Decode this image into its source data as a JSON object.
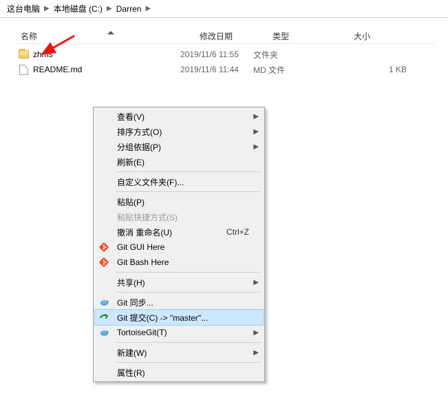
{
  "breadcrumb": {
    "seg1": "这台电脑",
    "seg2": "本地磁盘 (C:)",
    "seg3": "Darren"
  },
  "columns": {
    "name": "名称",
    "date": "修改日期",
    "type": "类型",
    "size": "大小"
  },
  "files": [
    {
      "name": "zhms",
      "date": "2019/11/6 11:55",
      "type": "文件夹",
      "size": "",
      "kind": "folder"
    },
    {
      "name": "README.md",
      "date": "2019/11/6 11:44",
      "type": "MD 文件",
      "size": "1 KB",
      "kind": "file"
    }
  ],
  "menu": {
    "view": "查看(V)",
    "sort": "排序方式(O)",
    "group": "分组依据(P)",
    "refresh": "刷新(E)",
    "customize": "自定义文件夹(F)...",
    "paste": "粘贴(P)",
    "paste_shortcut": "粘贴快捷方式(S)",
    "undo": "撤消 重命名(U)",
    "undo_key": "Ctrl+Z",
    "git_gui": "Git GUI Here",
    "git_bash": "Git Bash Here",
    "share": "共享(H)",
    "git_sync": "Git 同步...",
    "git_commit": "Git 提交(C) -> \"master\"...",
    "tortoise": "TortoiseGit(T)",
    "new": "新建(W)",
    "props": "属性(R)"
  }
}
